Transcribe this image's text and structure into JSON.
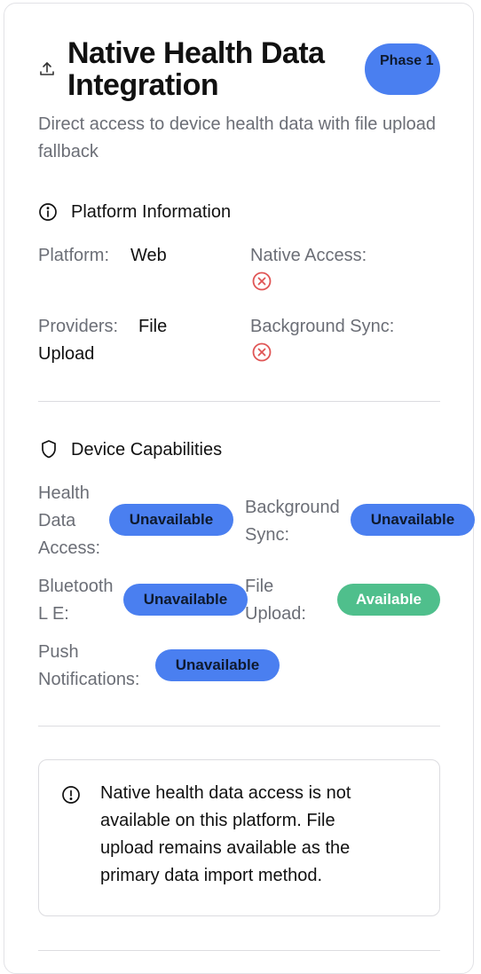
{
  "header": {
    "title": "Native Health Data Integration",
    "badge": "Phase 1",
    "description": "Direct access to device health data with file upload fallback",
    "icon": "upload-icon"
  },
  "platform_info": {
    "heading": "Platform Information",
    "icon": "info-icon",
    "platform_label": "Platform:",
    "platform_value": "Web",
    "native_access_label": "Native Access:",
    "native_access_status": "x-circle-icon",
    "providers_label": "Providers:",
    "providers_value_line1": "File",
    "providers_value_line2": "Upload",
    "background_sync_label": "Background Sync:",
    "background_sync_status": "x-circle-icon"
  },
  "capabilities": {
    "heading": "Device Capabilities",
    "icon": "shield-icon",
    "items": [
      {
        "label_lines": [
          "Health",
          "Data",
          "Access:"
        ],
        "status": "Unavailable"
      },
      {
        "label_lines": [
          "Background",
          "Sync:"
        ],
        "status": "Unavailable"
      },
      {
        "label_lines": [
          "Bluetooth",
          "L E:"
        ],
        "status": "Unavailable"
      },
      {
        "label_lines": [
          "File",
          "Upload:"
        ],
        "status": "Available"
      },
      {
        "label_lines": [
          "Push",
          "Notifications:"
        ],
        "status": "Unavailable"
      }
    ]
  },
  "notice": {
    "icon": "alert-circle-icon",
    "lines": [
      "Native health data access is not",
      "available on this platform. File",
      "upload remains available as the",
      "primary data import method."
    ]
  },
  "colors": {
    "accent": "#4a7ff0",
    "success": "#4fbf8c",
    "error": "#e05555",
    "muted_text": "#6b6e76"
  }
}
